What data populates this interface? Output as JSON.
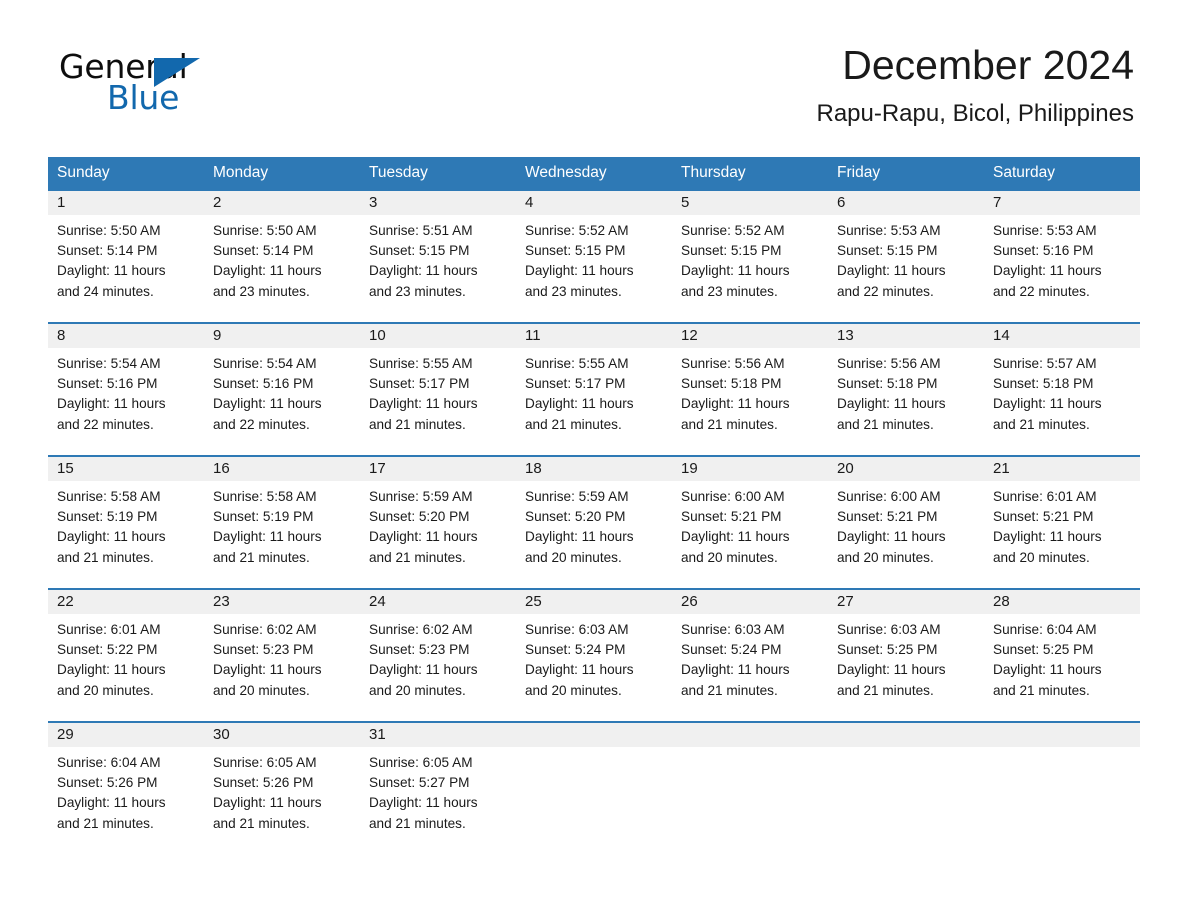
{
  "brand": {
    "name_part1": "General",
    "name_part2": "Blue",
    "triangle_icon": "triangle-icon",
    "accent_color": "#1268ad"
  },
  "header": {
    "title": "December 2024",
    "subtitle": "Rapu-Rapu, Bicol, Philippines"
  },
  "theme": {
    "header_blue": "#2e79b5",
    "row_rule_blue": "#2e79b5",
    "daynum_band": "#f0f0f0",
    "text": "#1a1a1a"
  },
  "weekdays": [
    "Sunday",
    "Monday",
    "Tuesday",
    "Wednesday",
    "Thursday",
    "Friday",
    "Saturday"
  ],
  "labels": {
    "sunrise_prefix": "Sunrise:",
    "sunset_prefix": "Sunset:",
    "daylight_prefix": "Daylight:"
  },
  "weeks": [
    [
      {
        "day": "1",
        "l1": "Sunrise: 5:50 AM",
        "l2": "Sunset: 5:14 PM",
        "l3": "Daylight: 11 hours",
        "l4": "and 24 minutes."
      },
      {
        "day": "2",
        "l1": "Sunrise: 5:50 AM",
        "l2": "Sunset: 5:14 PM",
        "l3": "Daylight: 11 hours",
        "l4": "and 23 minutes."
      },
      {
        "day": "3",
        "l1": "Sunrise: 5:51 AM",
        "l2": "Sunset: 5:15 PM",
        "l3": "Daylight: 11 hours",
        "l4": "and 23 minutes."
      },
      {
        "day": "4",
        "l1": "Sunrise: 5:52 AM",
        "l2": "Sunset: 5:15 PM",
        "l3": "Daylight: 11 hours",
        "l4": "and 23 minutes."
      },
      {
        "day": "5",
        "l1": "Sunrise: 5:52 AM",
        "l2": "Sunset: 5:15 PM",
        "l3": "Daylight: 11 hours",
        "l4": "and 23 minutes."
      },
      {
        "day": "6",
        "l1": "Sunrise: 5:53 AM",
        "l2": "Sunset: 5:15 PM",
        "l3": "Daylight: 11 hours",
        "l4": "and 22 minutes."
      },
      {
        "day": "7",
        "l1": "Sunrise: 5:53 AM",
        "l2": "Sunset: 5:16 PM",
        "l3": "Daylight: 11 hours",
        "l4": "and 22 minutes."
      }
    ],
    [
      {
        "day": "8",
        "l1": "Sunrise: 5:54 AM",
        "l2": "Sunset: 5:16 PM",
        "l3": "Daylight: 11 hours",
        "l4": "and 22 minutes."
      },
      {
        "day": "9",
        "l1": "Sunrise: 5:54 AM",
        "l2": "Sunset: 5:16 PM",
        "l3": "Daylight: 11 hours",
        "l4": "and 22 minutes."
      },
      {
        "day": "10",
        "l1": "Sunrise: 5:55 AM",
        "l2": "Sunset: 5:17 PM",
        "l3": "Daylight: 11 hours",
        "l4": "and 21 minutes."
      },
      {
        "day": "11",
        "l1": "Sunrise: 5:55 AM",
        "l2": "Sunset: 5:17 PM",
        "l3": "Daylight: 11 hours",
        "l4": "and 21 minutes."
      },
      {
        "day": "12",
        "l1": "Sunrise: 5:56 AM",
        "l2": "Sunset: 5:18 PM",
        "l3": "Daylight: 11 hours",
        "l4": "and 21 minutes."
      },
      {
        "day": "13",
        "l1": "Sunrise: 5:56 AM",
        "l2": "Sunset: 5:18 PM",
        "l3": "Daylight: 11 hours",
        "l4": "and 21 minutes."
      },
      {
        "day": "14",
        "l1": "Sunrise: 5:57 AM",
        "l2": "Sunset: 5:18 PM",
        "l3": "Daylight: 11 hours",
        "l4": "and 21 minutes."
      }
    ],
    [
      {
        "day": "15",
        "l1": "Sunrise: 5:58 AM",
        "l2": "Sunset: 5:19 PM",
        "l3": "Daylight: 11 hours",
        "l4": "and 21 minutes."
      },
      {
        "day": "16",
        "l1": "Sunrise: 5:58 AM",
        "l2": "Sunset: 5:19 PM",
        "l3": "Daylight: 11 hours",
        "l4": "and 21 minutes."
      },
      {
        "day": "17",
        "l1": "Sunrise: 5:59 AM",
        "l2": "Sunset: 5:20 PM",
        "l3": "Daylight: 11 hours",
        "l4": "and 21 minutes."
      },
      {
        "day": "18",
        "l1": "Sunrise: 5:59 AM",
        "l2": "Sunset: 5:20 PM",
        "l3": "Daylight: 11 hours",
        "l4": "and 20 minutes."
      },
      {
        "day": "19",
        "l1": "Sunrise: 6:00 AM",
        "l2": "Sunset: 5:21 PM",
        "l3": "Daylight: 11 hours",
        "l4": "and 20 minutes."
      },
      {
        "day": "20",
        "l1": "Sunrise: 6:00 AM",
        "l2": "Sunset: 5:21 PM",
        "l3": "Daylight: 11 hours",
        "l4": "and 20 minutes."
      },
      {
        "day": "21",
        "l1": "Sunrise: 6:01 AM",
        "l2": "Sunset: 5:21 PM",
        "l3": "Daylight: 11 hours",
        "l4": "and 20 minutes."
      }
    ],
    [
      {
        "day": "22",
        "l1": "Sunrise: 6:01 AM",
        "l2": "Sunset: 5:22 PM",
        "l3": "Daylight: 11 hours",
        "l4": "and 20 minutes."
      },
      {
        "day": "23",
        "l1": "Sunrise: 6:02 AM",
        "l2": "Sunset: 5:23 PM",
        "l3": "Daylight: 11 hours",
        "l4": "and 20 minutes."
      },
      {
        "day": "24",
        "l1": "Sunrise: 6:02 AM",
        "l2": "Sunset: 5:23 PM",
        "l3": "Daylight: 11 hours",
        "l4": "and 20 minutes."
      },
      {
        "day": "25",
        "l1": "Sunrise: 6:03 AM",
        "l2": "Sunset: 5:24 PM",
        "l3": "Daylight: 11 hours",
        "l4": "and 20 minutes."
      },
      {
        "day": "26",
        "l1": "Sunrise: 6:03 AM",
        "l2": "Sunset: 5:24 PM",
        "l3": "Daylight: 11 hours",
        "l4": "and 21 minutes."
      },
      {
        "day": "27",
        "l1": "Sunrise: 6:03 AM",
        "l2": "Sunset: 5:25 PM",
        "l3": "Daylight: 11 hours",
        "l4": "and 21 minutes."
      },
      {
        "day": "28",
        "l1": "Sunrise: 6:04 AM",
        "l2": "Sunset: 5:25 PM",
        "l3": "Daylight: 11 hours",
        "l4": "and 21 minutes."
      }
    ],
    [
      {
        "day": "29",
        "l1": "Sunrise: 6:04 AM",
        "l2": "Sunset: 5:26 PM",
        "l3": "Daylight: 11 hours",
        "l4": "and 21 minutes."
      },
      {
        "day": "30",
        "l1": "Sunrise: 6:05 AM",
        "l2": "Sunset: 5:26 PM",
        "l3": "Daylight: 11 hours",
        "l4": "and 21 minutes."
      },
      {
        "day": "31",
        "l1": "Sunrise: 6:05 AM",
        "l2": "Sunset: 5:27 PM",
        "l3": "Daylight: 11 hours",
        "l4": "and 21 minutes."
      },
      {
        "day": "",
        "l1": "",
        "l2": "",
        "l3": "",
        "l4": ""
      },
      {
        "day": "",
        "l1": "",
        "l2": "",
        "l3": "",
        "l4": ""
      },
      {
        "day": "",
        "l1": "",
        "l2": "",
        "l3": "",
        "l4": ""
      },
      {
        "day": "",
        "l1": "",
        "l2": "",
        "l3": "",
        "l4": ""
      }
    ]
  ]
}
